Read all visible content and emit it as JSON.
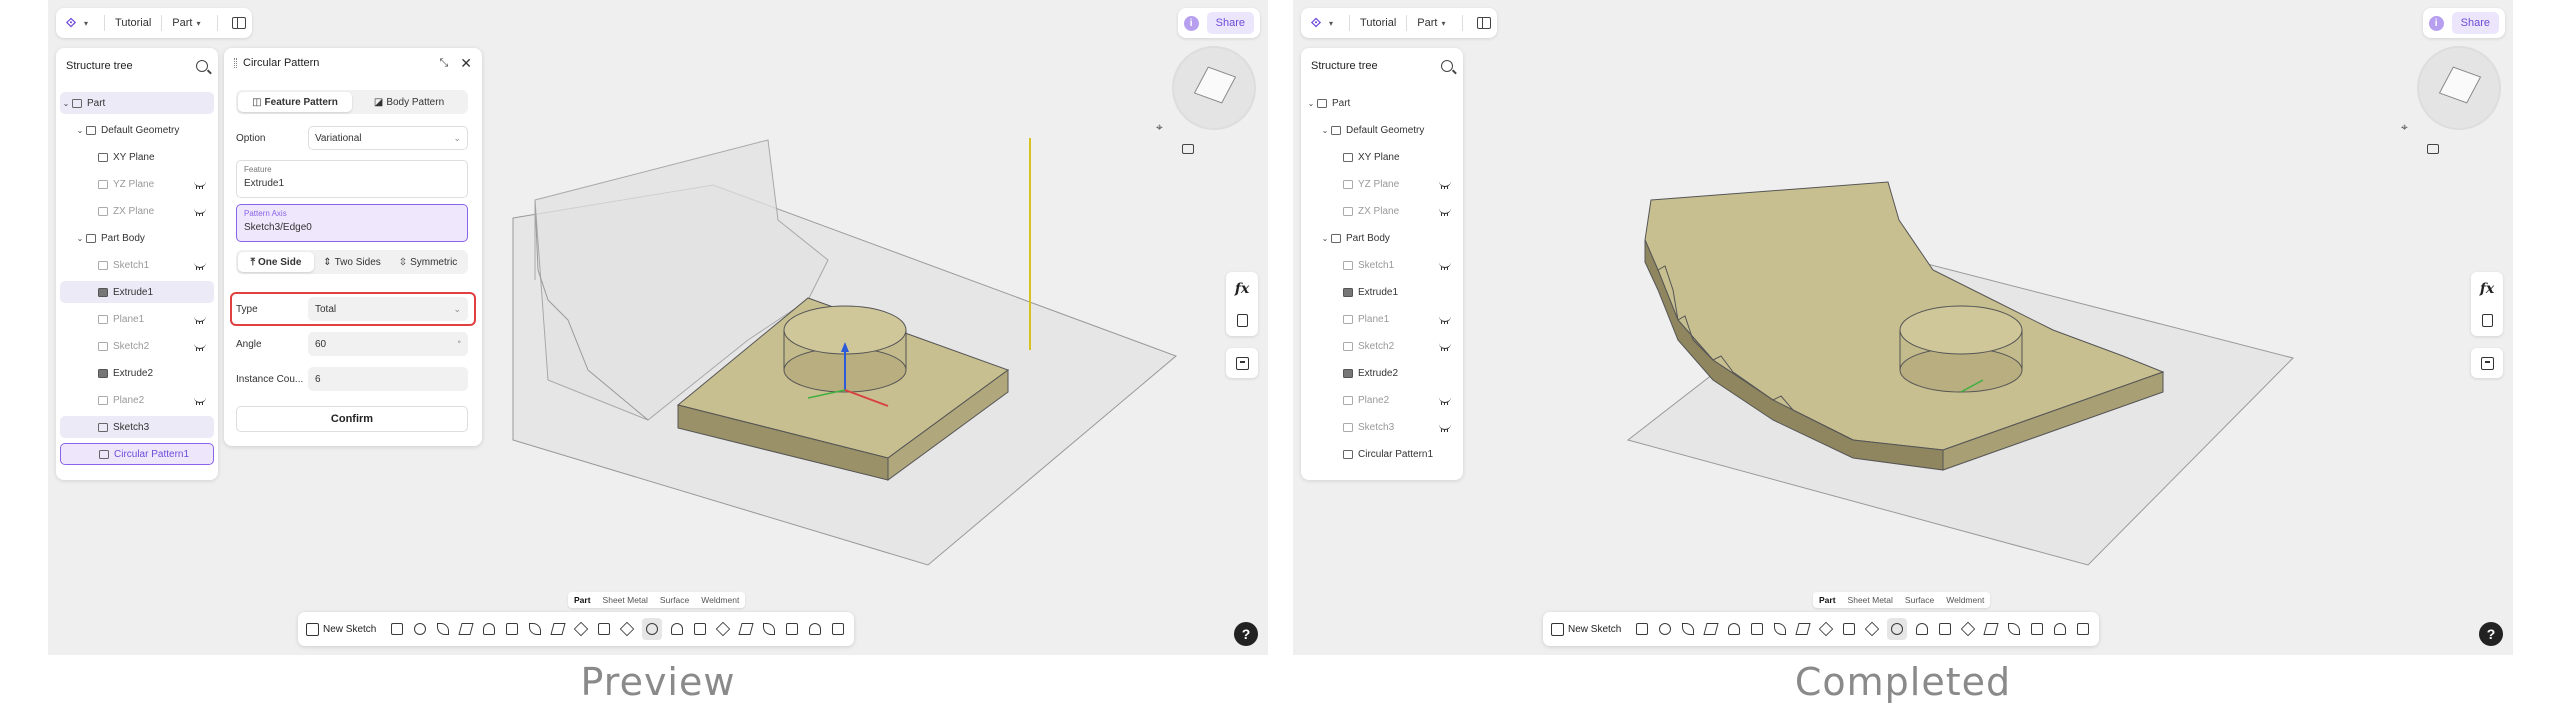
{
  "captions": {
    "left": "Preview",
    "right": "Completed"
  },
  "topbar": {
    "breadcrumb_1": "Tutorial",
    "breadcrumb_2": "Part",
    "share": "Share",
    "info": "i"
  },
  "tree": {
    "title": "Structure tree",
    "items": [
      {
        "label": "Part"
      },
      {
        "label": "Default Geometry"
      },
      {
        "label": "XY Plane"
      },
      {
        "label": "YZ Plane"
      },
      {
        "label": "ZX Plane"
      },
      {
        "label": "Part Body"
      },
      {
        "label": "Sketch1"
      },
      {
        "label": "Extrude1"
      },
      {
        "label": "Plane1"
      },
      {
        "label": "Sketch2"
      },
      {
        "label": "Extrude2"
      },
      {
        "label": "Plane2"
      },
      {
        "label": "Sketch3"
      },
      {
        "label": "Circular Pattern1"
      }
    ]
  },
  "circular_pattern": {
    "title": "Circular Pattern",
    "tabs": [
      "Feature Pattern",
      "Body Pattern"
    ],
    "option_label": "Option",
    "option_value": "Variational",
    "feature_label": "Feature",
    "feature_value": "Extrude1",
    "axis_label": "Pattern Axis",
    "axis_value": "Sketch3/Edge0",
    "sides": [
      "One Side",
      "Two Sides",
      "Symmetric"
    ],
    "type_label": "Type",
    "type_value": "Total",
    "angle_label": "Angle",
    "angle_value": "60",
    "angle_unit": "°",
    "count_label": "Instance Cou...",
    "count_value": "6",
    "confirm": "Confirm"
  },
  "right_tools": {
    "fx": "fx"
  },
  "modes": [
    "Part",
    "Sheet Metal",
    "Surface",
    "Weldment"
  ],
  "toolbar": {
    "new_sketch": "New Sketch"
  },
  "help": "?",
  "colors": {
    "accent": "#6f4bd8",
    "solid": "#bdb48a",
    "highlight_red": "#e04040"
  }
}
